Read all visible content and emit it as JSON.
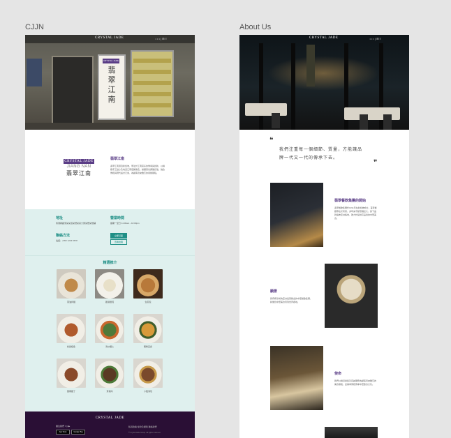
{
  "frames": {
    "frame1_label": "CJJN",
    "frame2_label": "About Us"
  },
  "nav": {
    "logo": "CRYSTAL JADE",
    "menu": "• • •  | ⊞  ≡"
  },
  "cjjn": {
    "signboard_tag": "CRYSTAL JADE",
    "signboard_chars": "翡 翠 江 南",
    "brand_tag": "CRYSTAL JADE",
    "brand_en": "JIANG NAN",
    "brand_zh": "翡翠江南",
    "intro_title": "翡翠江南",
    "intro_text": "翡翠江南源自新加坡，專注於江南菜系的傳承與創新，以精緻手工點心及地道江南佳餚聞名。餐廳環境典雅舒適，融合傳統與現代設計元素，為顧客帶來難忘的用餐體驗。",
    "info": {
      "address_h": "地址",
      "address_t": "香港銅鑼灣某某道某號某某大廈某層某號舖",
      "hours_h": "營業時間",
      "hours_t": "星期一至日  11:00am - 10:00pm",
      "contact_h": "聯絡方法",
      "contact_t": "電話：+852 1234 5678",
      "btn_primary": "立即訂座",
      "btn_secondary": "查看地圖"
    },
    "dishes_title": "精選推介",
    "dishes": [
      {
        "name": "蔥油拌麵"
      },
      {
        "name": "雞湯餛飩"
      },
      {
        "name": "生煎包"
      },
      {
        "name": "松鼠桂魚"
      },
      {
        "name": "清炒蝦仁"
      },
      {
        "name": "蟹粉豆腐"
      },
      {
        "name": "醬爆雞丁"
      },
      {
        "name": "東坡肉"
      },
      {
        "name": "小籠湯包"
      }
    ],
    "footer": {
      "logo": "CRYSTAL JADE",
      "follow": "關注我們  f  ◎  ▶",
      "app_store": "App Store",
      "google_play": "Google Play",
      "links": "私隱政策   條款及細則   聯絡我們",
      "copyright": "© Crystal Jade Group. All rights reserved."
    }
  },
  "about": {
    "quote_line1": "我們注重每一個細節、質量，方能讓品",
    "quote_line2": "牌一代又一代的傳承下去。",
    "quote_open": "❝",
    "quote_close": "❞",
    "sections": [
      {
        "title": "翡翠餐飲集團的開始",
        "text": "翡翠餐飲集團於1991年在新加坡成立，首家餐廳專注於粵菜，多年來不斷發展壯大，旗下品牌遍佈亞洲各地，致力於提供高品質的中華美食。"
      },
      {
        "title": "願景",
        "text": "我們希望成為亞洲最受歡迎的中華餐飲集團，將優質中華美食帶到世界各地。"
      },
      {
        "title": "使命",
        "text": "我們以精湛廚藝及真誠服務為顧客帶來難忘的美食體驗，並秉承傳統傳承中華飲食文化。"
      }
    ]
  },
  "colors": {
    "brand_purple": "#5a3d86",
    "teal": "#1f8f86",
    "footer_dark": "#2a0f35"
  }
}
